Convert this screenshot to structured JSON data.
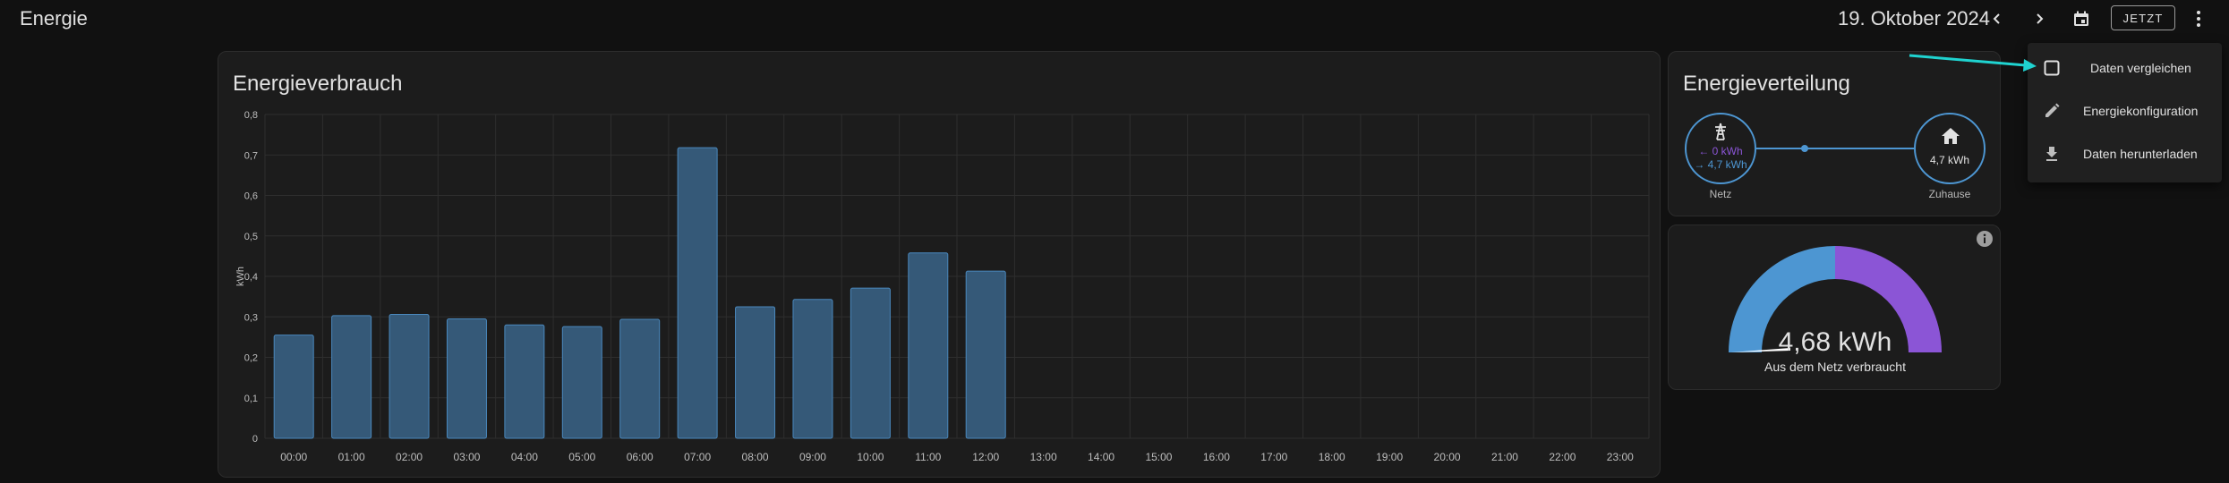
{
  "topbar": {
    "title": "Energie",
    "date": "19. Oktober 2024",
    "now_label": "JETZT"
  },
  "icons": {
    "prev": "chevron-left-icon",
    "next": "chevron-right-icon",
    "calendar": "calendar-icon",
    "more": "dots-vertical-icon",
    "info": "info-icon"
  },
  "colors": {
    "accent_grid": "#4d96d2",
    "solar_purple": "#8b55d6",
    "bar_fill": "#355978",
    "bar_stroke": "#4a88bd",
    "arrow": "#1fd3d0"
  },
  "usage_card": {
    "title": "Energieverbrauch"
  },
  "chart_data": {
    "type": "bar",
    "title": "Energieverbrauch",
    "ylabel": "kWh",
    "xlabel": "",
    "ylim": [
      0,
      0.8
    ],
    "yticks": [
      "0",
      "0,1",
      "0,2",
      "0,3",
      "0,4",
      "0,5",
      "0,6",
      "0,7",
      "0,8"
    ],
    "categories": [
      "00:00",
      "01:00",
      "02:00",
      "03:00",
      "04:00",
      "05:00",
      "06:00",
      "07:00",
      "08:00",
      "09:00",
      "10:00",
      "11:00",
      "12:00",
      "13:00",
      "14:00",
      "15:00",
      "16:00",
      "17:00",
      "18:00",
      "19:00",
      "20:00",
      "21:00",
      "22:00",
      "23:00"
    ],
    "values": [
      0.255,
      0.303,
      0.306,
      0.295,
      0.28,
      0.276,
      0.294,
      0.718,
      0.325,
      0.343,
      0.371,
      0.458,
      0.413,
      null,
      null,
      null,
      null,
      null,
      null,
      null,
      null,
      null,
      null,
      null
    ],
    "grid": true
  },
  "distribution": {
    "title": "Energieverteilung",
    "grid_in": "← 0 kWh",
    "grid_out": "→ 4,7 kWh",
    "grid_label": "Netz",
    "home_value": "4,7 kWh",
    "home_label": "Zuhause"
  },
  "gauge": {
    "value_text": "4,68 kWh",
    "caption": "Aus dem Netz verbraucht",
    "fraction_grid": 0.5
  },
  "menu": {
    "items": [
      {
        "label": "Daten vergleichen",
        "icon": "checkbox-icon"
      },
      {
        "label": "Energiekonfiguration",
        "icon": "pencil-icon"
      },
      {
        "label": "Daten herunterladen",
        "icon": "download-icon"
      }
    ]
  }
}
